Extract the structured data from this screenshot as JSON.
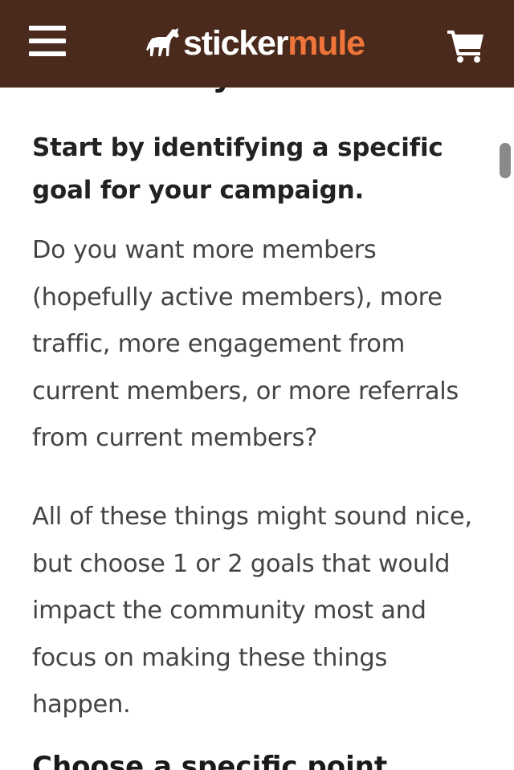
{
  "navbar": {
    "logo_text_primary": "sticker",
    "logo_text_accent": "mule",
    "colors": {
      "background": "#4a2a1c",
      "logo_primary": "#ffffff",
      "logo_accent": "#f0753a"
    },
    "icons": {
      "menu": "hamburger-menu-icon",
      "logo": "mule-logo-icon",
      "cart": "shopping-cart-icon"
    }
  },
  "article": {
    "cut_heading": "community",
    "subheading": "Start by identifying a specific goal for your campaign.",
    "paragraphs": [
      "Do you want more members (hopefully active members), more traffic, more engagement from current members, or more referrals from current members?",
      "All of these things might sound nice, but choose 1 or 2 goals that would impact the community most and focus on making these things happen."
    ],
    "next_heading": "Choose a specific point"
  }
}
